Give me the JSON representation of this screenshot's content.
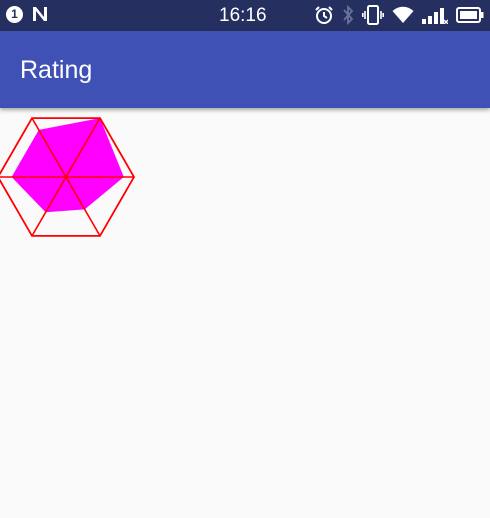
{
  "status_bar": {
    "notification_count": "1",
    "time": "16:16",
    "icons": [
      "notification-badge-icon",
      "n-logo-icon",
      "alarm-icon",
      "bluetooth-icon",
      "vibrate-icon",
      "wifi-icon",
      "signal-icon",
      "battery-icon"
    ]
  },
  "app_bar": {
    "title": "Rating"
  },
  "colors": {
    "status_bar": "#253060",
    "app_bar": "#3f51b5",
    "background": "#fafafa",
    "grid": "#ff0000",
    "fill": "#ff00ff"
  },
  "chart_data": {
    "type": "radar",
    "axes": 6,
    "max": 1,
    "values": [
      0.8,
      0.8,
      1.0,
      0.85,
      0.55,
      0.6
    ]
  }
}
